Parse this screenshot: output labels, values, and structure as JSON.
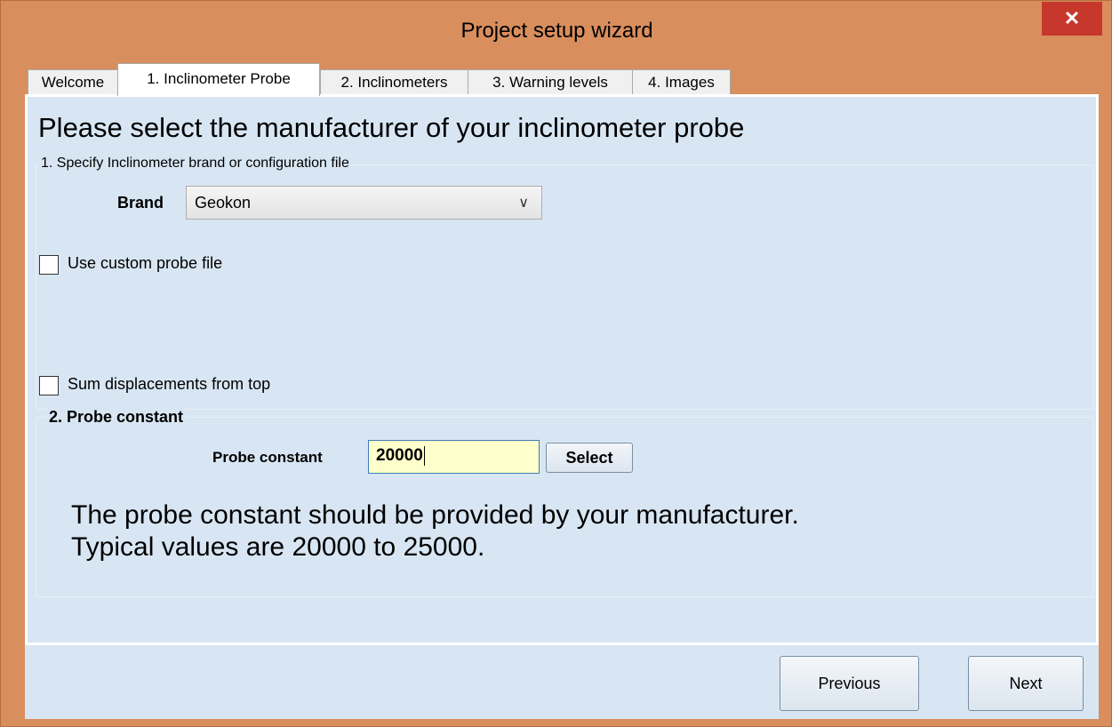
{
  "window": {
    "title": "Project setup wizard",
    "close_glyph": "✕"
  },
  "tabs": [
    {
      "label": "Welcome",
      "active": false
    },
    {
      "label": "1. Inclinometer Probe",
      "active": true
    },
    {
      "label": "2. Inclinometers",
      "active": false
    },
    {
      "label": "3. Warning levels",
      "active": false
    },
    {
      "label": "4. Images",
      "active": false
    }
  ],
  "page": {
    "heading": "Please select the manufacturer of your inclinometer probe",
    "group1": {
      "title": "1. Specify Inclinometer brand or configuration file",
      "brand_label": "Brand",
      "brand_value": "Geokon"
    },
    "custom_probe_label": "Use custom probe file",
    "custom_probe_checked": false,
    "sum_displacements_label": "Sum displacements from top",
    "sum_displacements_checked": false,
    "group2": {
      "title": "2. Probe constant",
      "probe_constant_label": "Probe constant",
      "probe_constant_value": "20000",
      "select_button": "Select",
      "info_line1": "The probe constant should be provided by your manufacturer.",
      "info_line2": "Typical values are 20000 to 25000."
    }
  },
  "footer": {
    "previous_button": "Previous",
    "next_button": "Next"
  },
  "colors": {
    "window_frame": "#d98e5e",
    "panel_background": "#d8e6f3",
    "close_button": "#c7372c",
    "input_highlight": "#ffffcc"
  },
  "icons": {
    "close": "close-icon",
    "dropdown": "chevron-down-icon"
  }
}
